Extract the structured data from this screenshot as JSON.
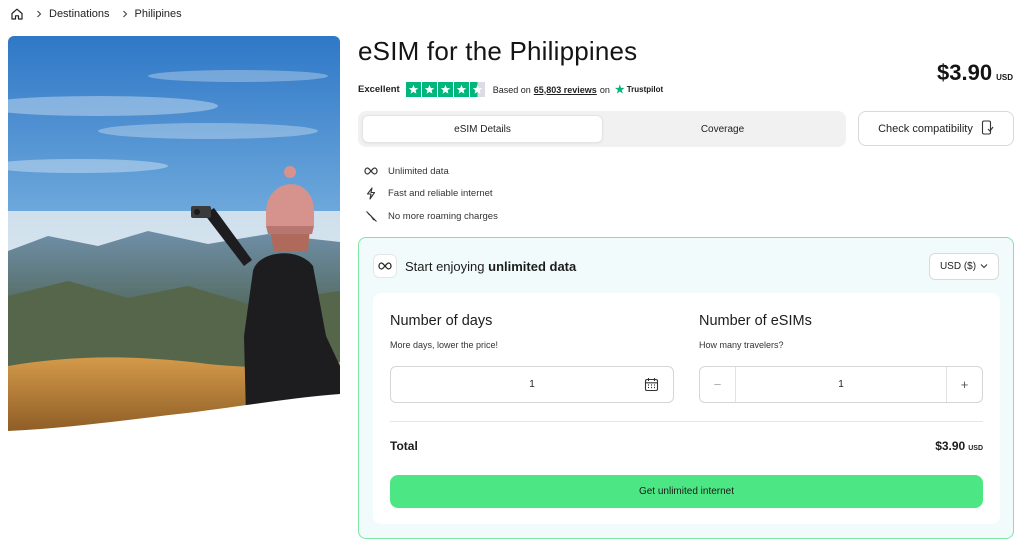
{
  "breadcrumb": {
    "home_icon": "home-icon",
    "items": [
      "Destinations",
      "Philipines"
    ]
  },
  "product": {
    "title": "eSIM for the Philippines",
    "price": "$3.90",
    "currency": "USD"
  },
  "rating": {
    "label": "Excellent",
    "stars": 4.5,
    "based_on": "Based on",
    "reviews": "65,803 reviews",
    "on": "on",
    "provider": "Trustpilot",
    "brand_color": "#00b67a"
  },
  "tabs": [
    {
      "label": "eSIM Details",
      "active": true
    },
    {
      "label": "Coverage",
      "active": false
    }
  ],
  "check_compatibility": {
    "label": "Check compatibility",
    "icon": "phone-check-icon"
  },
  "features": [
    {
      "icon": "infinity-icon",
      "label": "Unlimited data"
    },
    {
      "icon": "bolt-icon",
      "label": "Fast and reliable internet"
    },
    {
      "icon": "no-roaming-icon",
      "label": "No more roaming charges"
    }
  ],
  "plan": {
    "heading_prefix": "Start enjoying",
    "heading_bold": "unlimited data",
    "currency_select": "USD ($)",
    "days": {
      "title": "Number of days",
      "subtitle": "More days, lower the price!",
      "value": "1"
    },
    "esims": {
      "title": "Number of eSIMs",
      "subtitle": "How many travelers?",
      "value": "1",
      "minus": "−",
      "plus": "+"
    },
    "total_label": "Total",
    "total_amount": "$3.90",
    "total_currency": "USD",
    "cta": "Get unlimited internet",
    "accent": "#4ce784"
  }
}
